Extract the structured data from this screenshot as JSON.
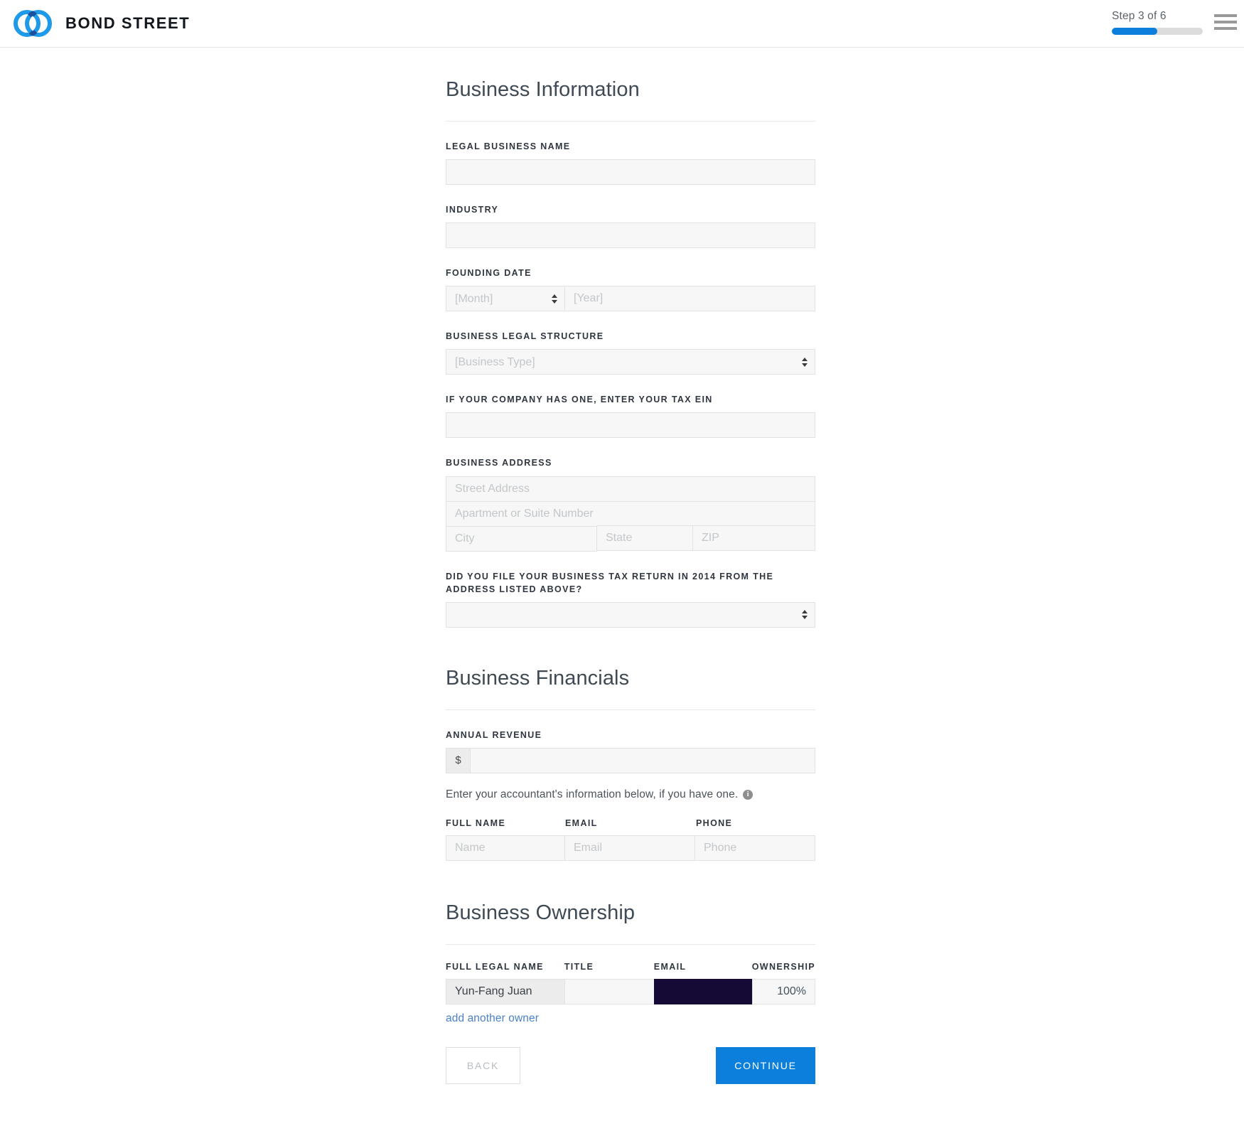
{
  "header": {
    "brand_name": "BOND STREET",
    "logo_icon": "two-interlocking-rings-logo",
    "step_text": "Step 3 of 6",
    "progress_percent": 50,
    "accent_color": "#0b7fdb",
    "menu_icon": "hamburger-menu-icon"
  },
  "sections": {
    "business_information": {
      "title": "Business Information",
      "legal_business_name": {
        "label": "LEGAL BUSINESS NAME",
        "value": "",
        "placeholder": ""
      },
      "industry": {
        "label": "INDUSTRY",
        "value": "",
        "placeholder": ""
      },
      "founding_date": {
        "label": "FOUNDING DATE",
        "month": {
          "value": "[Month]",
          "placeholder": "[Month]"
        },
        "year": {
          "value": "",
          "placeholder": "[Year]"
        }
      },
      "legal_structure": {
        "label": "BUSINESS LEGAL STRUCTURE",
        "value": "[Business Type]",
        "placeholder": "[Business Type]"
      },
      "tax_ein": {
        "label": "IF YOUR COMPANY HAS ONE, ENTER YOUR TAX EIN",
        "value": "",
        "placeholder": ""
      },
      "business_address": {
        "label": "BUSINESS ADDRESS",
        "street": {
          "value": "",
          "placeholder": "Street Address"
        },
        "apartment": {
          "value": "",
          "placeholder": "Apartment or Suite Number"
        },
        "city": {
          "value": "",
          "placeholder": "City"
        },
        "state": {
          "value": "",
          "placeholder": "State"
        },
        "zip": {
          "value": "",
          "placeholder": "ZIP"
        }
      },
      "tax_return_question": {
        "label": "DID YOU FILE YOUR BUSINESS TAX RETURN IN 2014 FROM THE ADDRESS LISTED ABOVE?",
        "value": "",
        "placeholder": ""
      }
    },
    "business_financials": {
      "title": "Business Financials",
      "annual_revenue": {
        "label": "ANNUAL REVENUE",
        "currency_symbol": "$",
        "value": "",
        "placeholder": ""
      },
      "accountant_helper_text": "Enter your accountant's information below, if you have one.",
      "accountant_info_icon": "info-icon",
      "accountant": {
        "full_name": {
          "label": "FULL NAME",
          "value": "",
          "placeholder": "Name"
        },
        "email": {
          "label": "EMAIL",
          "value": "",
          "placeholder": "Email"
        },
        "phone": {
          "label": "PHONE",
          "value": "",
          "placeholder": "Phone"
        }
      }
    },
    "business_ownership": {
      "title": "Business Ownership",
      "columns": {
        "full_legal_name": "FULL LEGAL NAME",
        "title": "TITLE",
        "email": "EMAIL",
        "ownership": "OWNERSHIP"
      },
      "owner_row": {
        "full_legal_name": "Yun-Fang Juan",
        "title": "",
        "email": "",
        "email_field_color": "#150a36",
        "ownership": "100%"
      },
      "add_owner_link": "add another owner"
    }
  },
  "footer": {
    "back_label": "BACK",
    "continue_label": "CONTINUE"
  }
}
